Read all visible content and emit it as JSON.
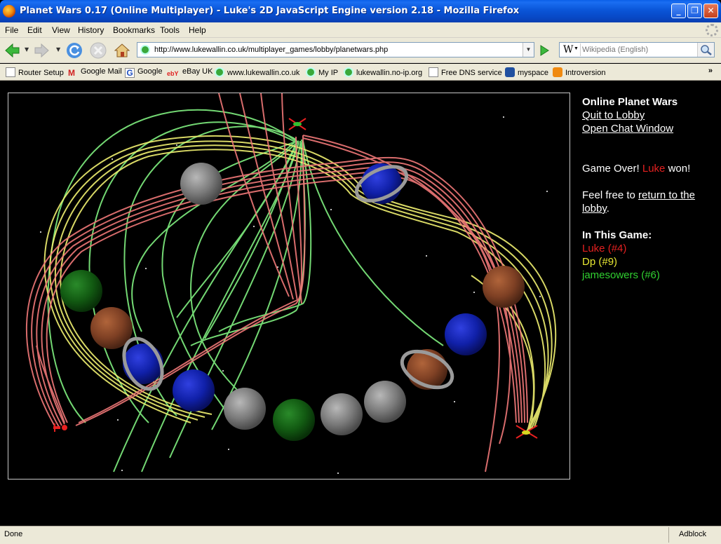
{
  "window": {
    "title": "Planet Wars 0.17 (Online Multiplayer) - Luke's 2D JavaScript Engine version 2.18 - Mozilla Firefox"
  },
  "menu": {
    "file": "File",
    "edit": "Edit",
    "view": "View",
    "history": "History",
    "bookmarks": "Bookmarks",
    "tools": "Tools",
    "help": "Help"
  },
  "nav": {
    "url": "http://www.lukewallin.co.uk/multiplayer_games/lobby/planetwars.php",
    "search_engine": "W",
    "search_placeholder": "Wikipedia (English)"
  },
  "bookmarks": [
    {
      "label": "Router Setup",
      "icon": "page-icon"
    },
    {
      "label": "Google Mail",
      "icon": "gmail-icon"
    },
    {
      "label": "Google",
      "icon": "google-icon"
    },
    {
      "label": "eBay UK",
      "icon": "ebay-icon"
    },
    {
      "label": "www.lukewallin.co.uk",
      "icon": "site-icon"
    },
    {
      "label": "My IP",
      "icon": "site-icon"
    },
    {
      "label": "lukewallin.no-ip.org",
      "icon": "site-icon"
    },
    {
      "label": "Free DNS service",
      "icon": "page-icon"
    },
    {
      "label": "myspace",
      "icon": "myspace-icon"
    },
    {
      "label": "Introversion",
      "icon": "rss-icon"
    }
  ],
  "bookmarks_more": "»",
  "sidebar": {
    "game_title": "Online Planet Wars",
    "quit_link": "Quit to Lobby",
    "chat_link": "Open Chat Window",
    "game_over_prefix": "Game Over!",
    "winner": "Luke",
    "won_suffix": "won!",
    "feel_free": "Feel free to",
    "return_link": "return to the lobby",
    "period": ".",
    "in_this_game": "In This Game:",
    "players": [
      {
        "name": "Luke",
        "rank": "(#4)",
        "color": "#e32020"
      },
      {
        "name": "Dp",
        "rank": "(#9)",
        "color": "#e8e832"
      },
      {
        "name": "jamesowers",
        "rank": "(#6)",
        "color": "#30d030"
      }
    ]
  },
  "status": {
    "text": "Done",
    "addon": "Adblock"
  },
  "game": {
    "colors": {
      "luke": "#f07878",
      "dp": "#f0f070",
      "james": "#80f080",
      "grey_planet": "#8a8a8a",
      "blue_planet": "#1a2ab8",
      "green_planet": "#1a6a1a",
      "brown_planet": "#8a4a2a"
    }
  }
}
